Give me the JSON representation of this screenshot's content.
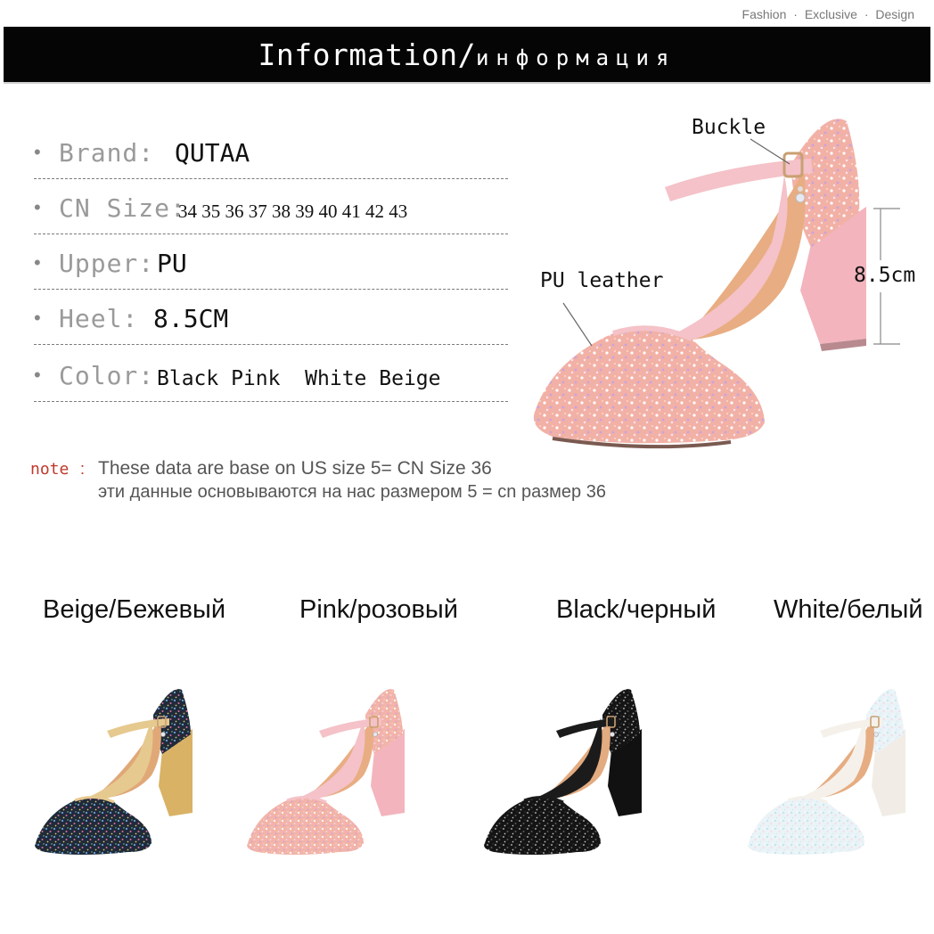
{
  "top_nav": {
    "items": [
      "Fashion",
      "Exclusive",
      "Design"
    ],
    "separator": "·"
  },
  "banner": {
    "title_en": "Information/",
    "title_ru": "информация"
  },
  "specs": [
    {
      "label": "Brand:",
      "value": "QUTAA"
    },
    {
      "label": "CN Size:",
      "value": "34 35 36 37 38 39 40 41 42 43"
    },
    {
      "label": "Upper: ",
      "value": "PU"
    },
    {
      "label": "Heel:",
      "value": "8.5CM"
    },
    {
      "label": "Color:",
      "value": "Black Pink  White Beige"
    }
  ],
  "note": {
    "key": "note",
    "colon": ":",
    "line_en": "These data are base on US size 5= CN Size 36",
    "line_ru": "эти данные основываются на нас размером 5 = cn размер 36"
  },
  "callouts": {
    "buckle": "Buckle",
    "pu_leather": "PU leather",
    "heel_height": "8.5cm"
  },
  "variants": [
    {
      "label": "Beige/Бежевый",
      "sparkle": "#1f2a3a",
      "spark_dots": [
        "#6fa0d8",
        "#d86f9f",
        "#e0c060",
        "#7fd0b0"
      ],
      "trim": "#e6c98f",
      "heel": "#d9b265",
      "inside": "#e0a877"
    },
    {
      "label": "Pink/розовый",
      "sparkle": "#f2b3a8",
      "spark_dots": [
        "#ffffff",
        "#f7d0e0",
        "#c8a0e0",
        "#ffd9c0"
      ],
      "trim": "#f4c2c8",
      "heel": "#f3b4bd",
      "inside": "#e8ad82"
    },
    {
      "label": "Black/черный",
      "sparkle": "#141414",
      "spark_dots": [
        "#8a8a8a",
        "#5a5a5a",
        "#bdbdbd",
        "#3a3a3a"
      ],
      "trim": "#1b1b1b",
      "heel": "#111111",
      "inside": "#e3ab80"
    },
    {
      "label": "White/белый",
      "sparkle": "#eaf3f6",
      "spark_dots": [
        "#bfe6f2",
        "#f6d6e6",
        "#d9e8ff",
        "#ffffff"
      ],
      "trim": "#f5f1ea",
      "heel": "#f1ede6",
      "inside": "#e6ad82"
    }
  ],
  "hero_colors": {
    "sparkle": "#f2b1a6",
    "trim": "#f4c2c8",
    "heel": "#f3b4bd",
    "inside": "#e8ad82"
  }
}
